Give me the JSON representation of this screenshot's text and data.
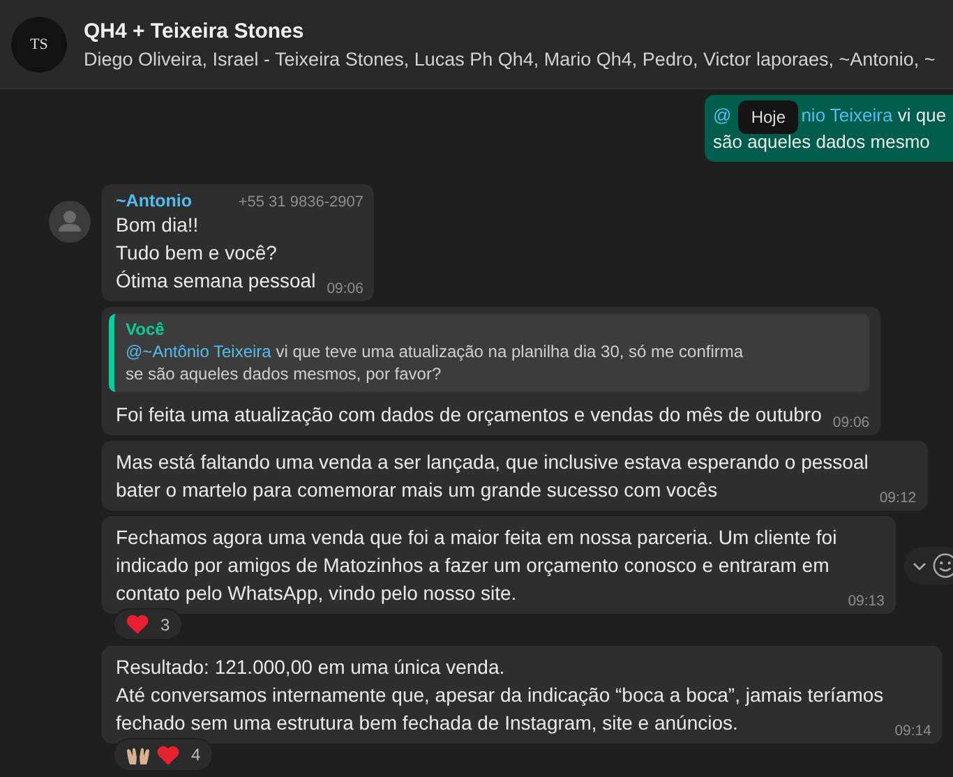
{
  "header": {
    "logo_text": "TS",
    "title": "QH4 + Teixeira Stones",
    "participants": "Diego Oliveira, Israel - Teixeira Stones, Lucas Ph Qh4, Mario Qh4, Pedro, Victor laporaes, ~Antonio, ~"
  },
  "outgoing": {
    "mention_start": "@",
    "mention_end": "nio Teixeira",
    "line_1": "vi que",
    "line_2": "são aqueles dados mesmo"
  },
  "date_pill": "Hoje",
  "messages": [
    {
      "kind": "first",
      "sender": "~Antonio",
      "phone": "+55 31 9836-2907",
      "lines": [
        "Bom dia!!",
        "Tudo bem e você?",
        "Ótima semana pessoal"
      ],
      "time": "09:06"
    },
    {
      "kind": "reply",
      "quote": {
        "author": "Você",
        "mention": "@~Antônio Teixeira",
        "lines": [
          "vi que teve uma atualização na planilha dia 30, só me confirma",
          "se são aqueles dados mesmos, por favor?"
        ]
      },
      "lines": [
        "Foi feita uma atualização com dados de orçamentos e vendas do mês de outubro"
      ],
      "time": "09:06"
    },
    {
      "kind": "plain",
      "lines": [
        "Mas está faltando uma venda a ser lançada, que inclusive estava esperando o pessoal",
        "bater o martelo para comemorar mais um grande sucesso com vocês"
      ],
      "time": "09:12"
    },
    {
      "kind": "plain",
      "hovered": true,
      "lines": [
        "Fechamos agora uma venda que foi a maior feita em nossa parceria. Um cliente foi",
        "indicado por amigos de Matozinhos a fazer um orçamento conosco e entraram em",
        "contato pelo WhatsApp, vindo pelo nosso site."
      ],
      "time": "09:13",
      "reactions": {
        "items": [
          {
            "kind": "heart"
          }
        ],
        "count": "3"
      }
    },
    {
      "kind": "plain",
      "lines": [
        "Resultado: 121.000,00 em uma única venda.",
        "Até conversamos internamente que, apesar da indicação “boca a boca”, jamais teríamos",
        "fechado sem uma estrutura bem fechada de Instagram, site e anúncios."
      ],
      "time": "09:14",
      "reactions": {
        "items": [
          {
            "kind": "raised-hands"
          },
          {
            "kind": "heart"
          }
        ],
        "count": "4"
      }
    }
  ]
}
